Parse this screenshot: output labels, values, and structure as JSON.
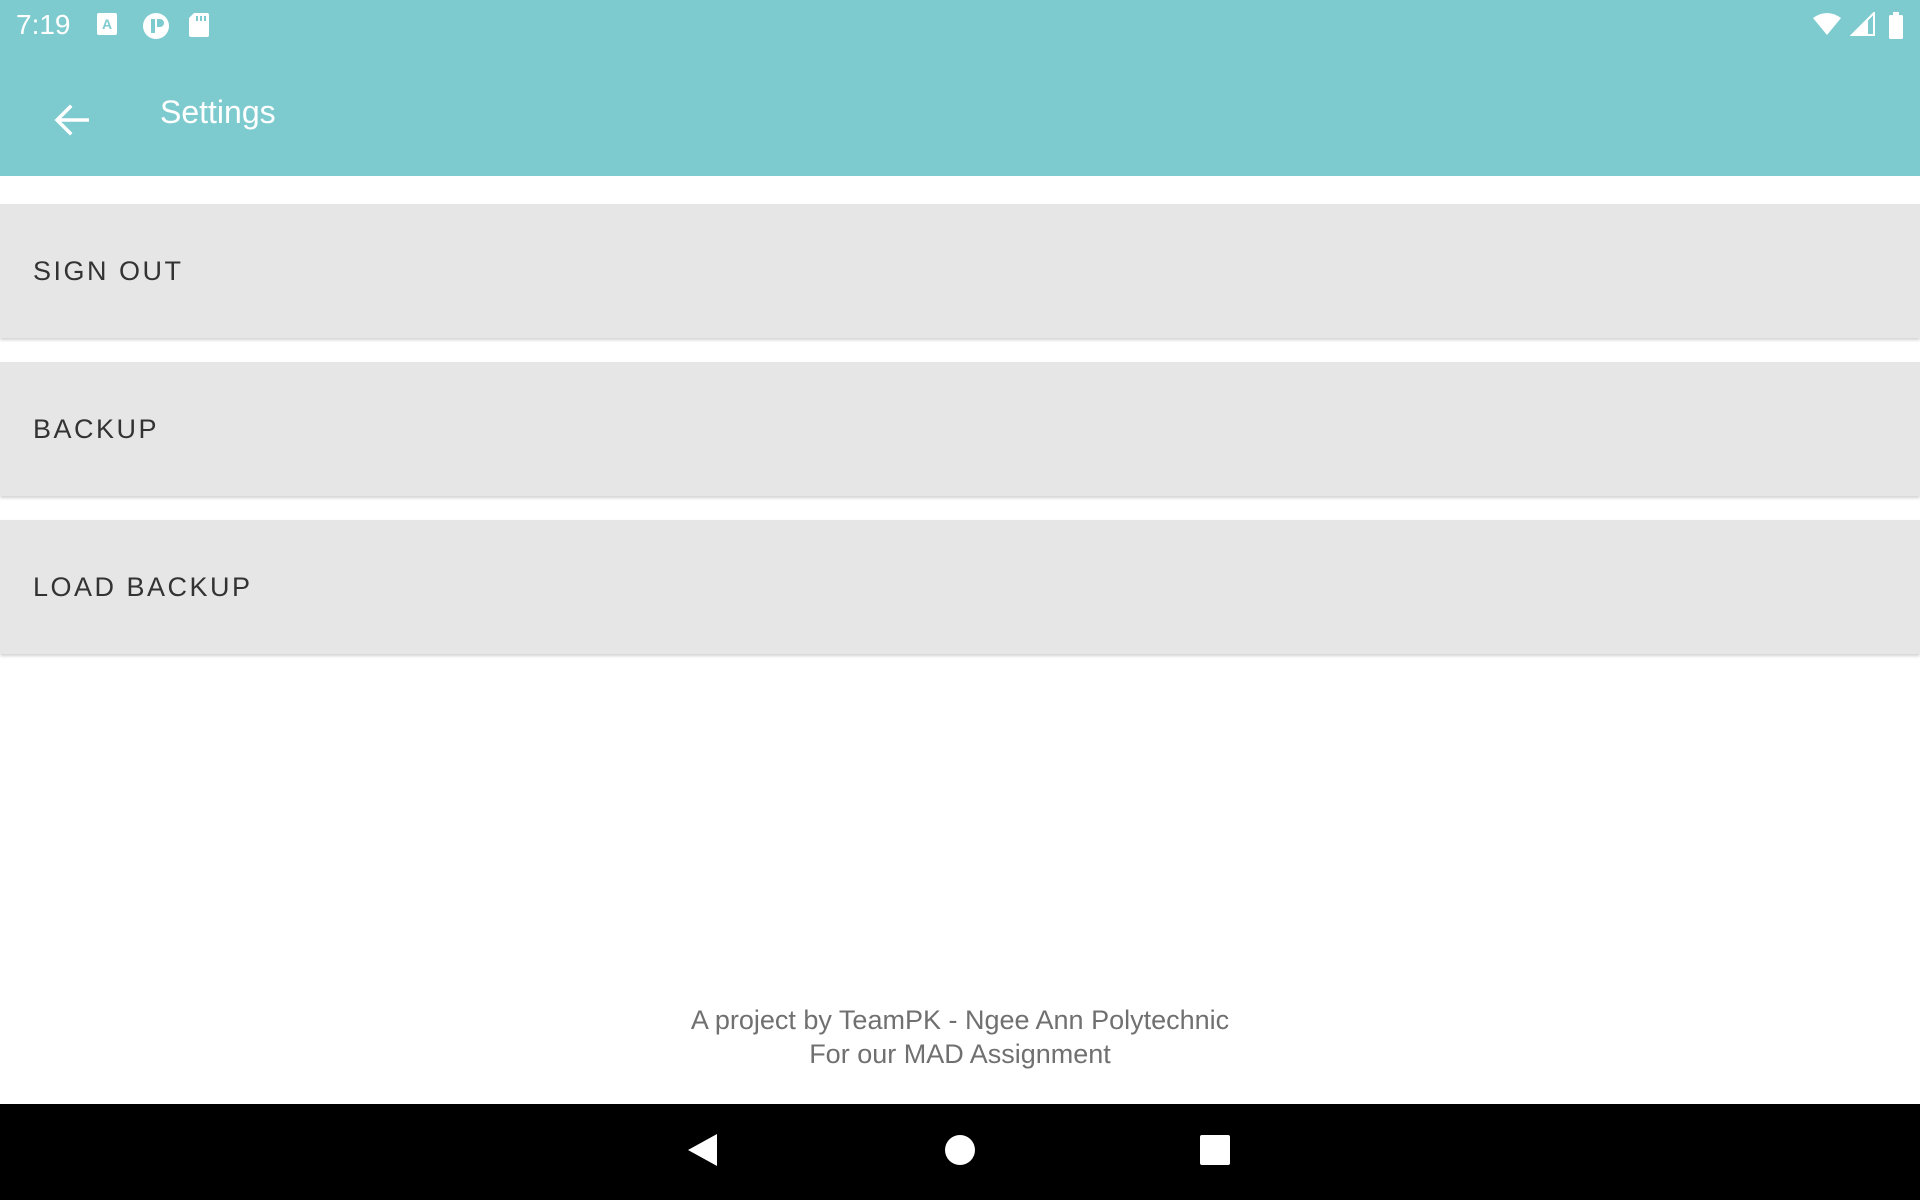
{
  "status_bar": {
    "time": "7:19",
    "left_icons": [
      "keyboard-a-icon",
      "pocket-app-icon",
      "sd-card-icon"
    ],
    "right_icons": [
      "wifi-icon",
      "cell-signal-icon",
      "battery-icon"
    ]
  },
  "app_bar": {
    "back_icon": "arrow-back-icon",
    "title": "Settings"
  },
  "buttons": [
    {
      "label": "SIGN OUT"
    },
    {
      "label": "BACKUP"
    },
    {
      "label": "LOAD BACKUP"
    }
  ],
  "footer": {
    "line1": "A project by TeamPK - Ngee Ann Polytechnic",
    "line2": "For our MAD Assignment"
  },
  "nav_bar": {
    "icons": [
      "nav-back-icon",
      "nav-home-icon",
      "nav-recents-icon"
    ]
  },
  "colors": {
    "app_bar": "#7ECBCF",
    "button_bg": "#E6E6E6",
    "button_text": "#333333",
    "footer_text": "#707070",
    "nav_bar": "#000000"
  }
}
